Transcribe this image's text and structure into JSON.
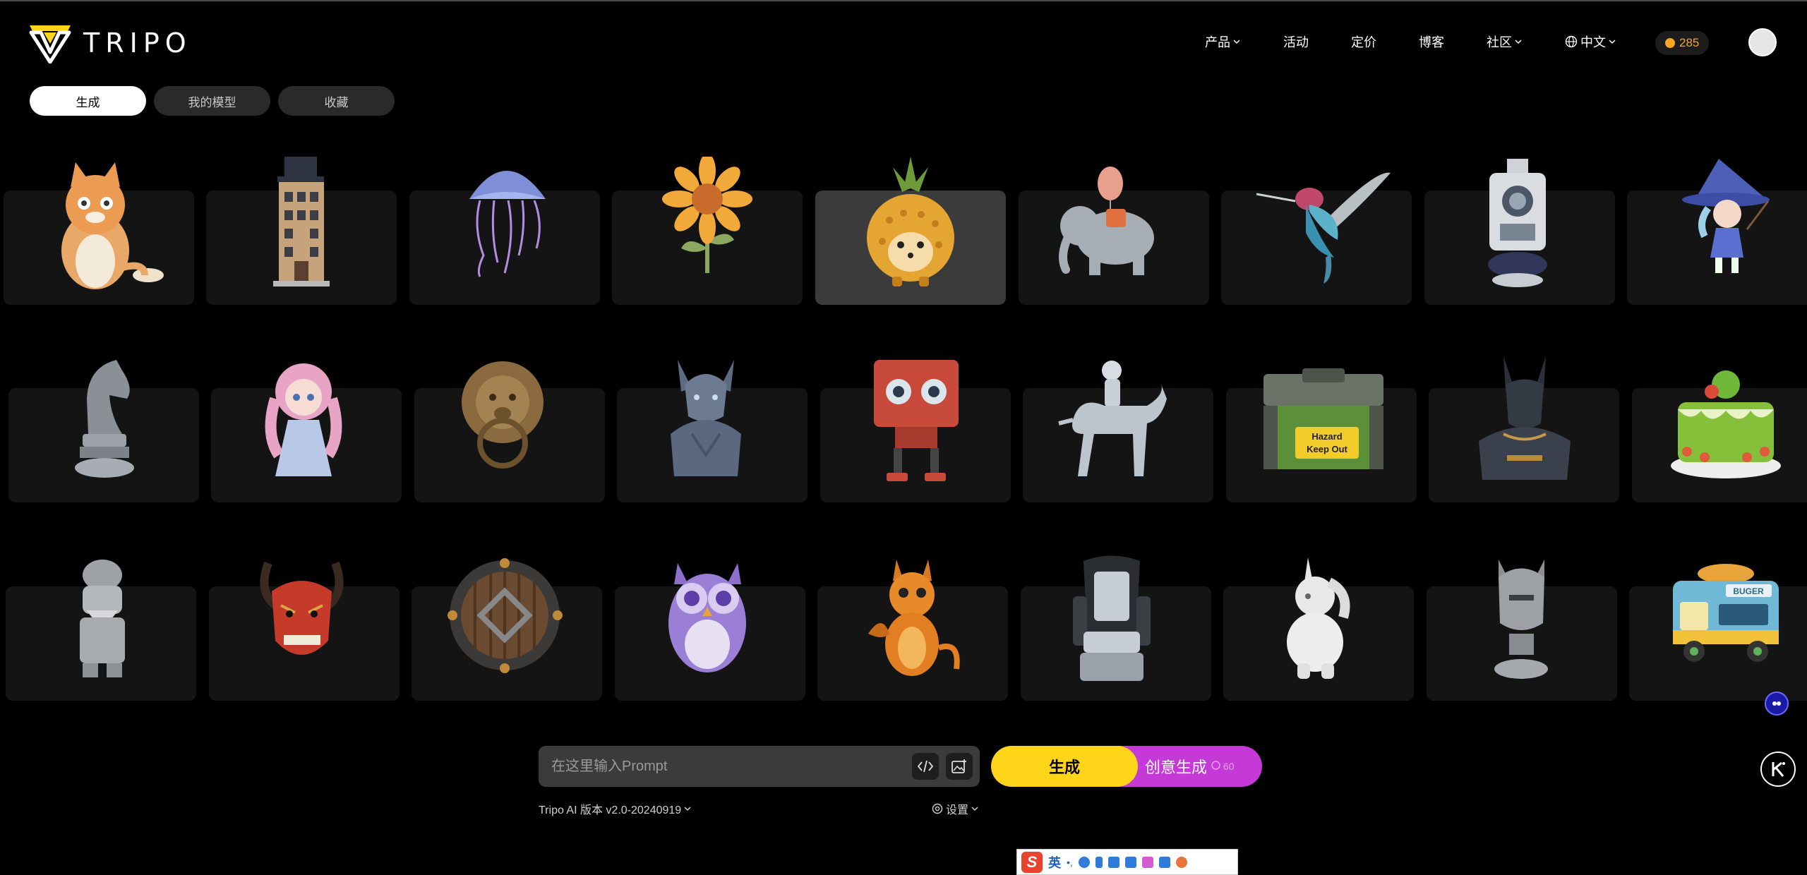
{
  "brand": {
    "name": "TRIPO",
    "accent": "#ffd51a"
  },
  "nav": {
    "items": [
      {
        "label": "产品",
        "dropdown": true
      },
      {
        "label": "活动",
        "dropdown": false
      },
      {
        "label": "定价",
        "dropdown": false
      },
      {
        "label": "博客",
        "dropdown": false
      },
      {
        "label": "社区",
        "dropdown": true
      }
    ],
    "language": "中文",
    "credits": "285"
  },
  "tabs": [
    {
      "label": "生成",
      "active": true
    },
    {
      "label": "我的模型",
      "active": false
    },
    {
      "label": "收藏",
      "active": false
    }
  ],
  "gallery": {
    "rows": [
      [
        "cat-figurine",
        "tophat-building",
        "jellyfish",
        "sunflower",
        "pineapple-hedgehog",
        "balloon-elephant",
        "hummingbird",
        "surveying-instrument",
        "witch-girl"
      ],
      [
        "chess-knight",
        "anime-girl",
        "lion-door-knocker",
        "dragon-bust",
        "boxy-robot",
        "astronaut-horse-rider",
        "hazard-chest",
        "anubis-bust",
        "green-cake"
      ],
      [
        "stone-dwarf",
        "oni-mask",
        "round-shield",
        "purple-owl",
        "orange-dragon",
        "gaming-chair",
        "unicorn-pony",
        "helmet-bust",
        "burger-truck"
      ]
    ],
    "highlighted": "pineapple-hedgehog",
    "chest_label_1": "Hazard",
    "chest_label_2": "Keep Out",
    "truck_label": "BUGER"
  },
  "prompt": {
    "placeholder": "在这里输入Prompt",
    "generate_label": "生成",
    "creative_label": "创意生成",
    "creative_cost": "60",
    "creative_color": "#c53ad6"
  },
  "footer": {
    "version": "Tripo AI 版本 v2.0-20240919",
    "settings": "设置"
  },
  "ime": {
    "lang": "英"
  }
}
